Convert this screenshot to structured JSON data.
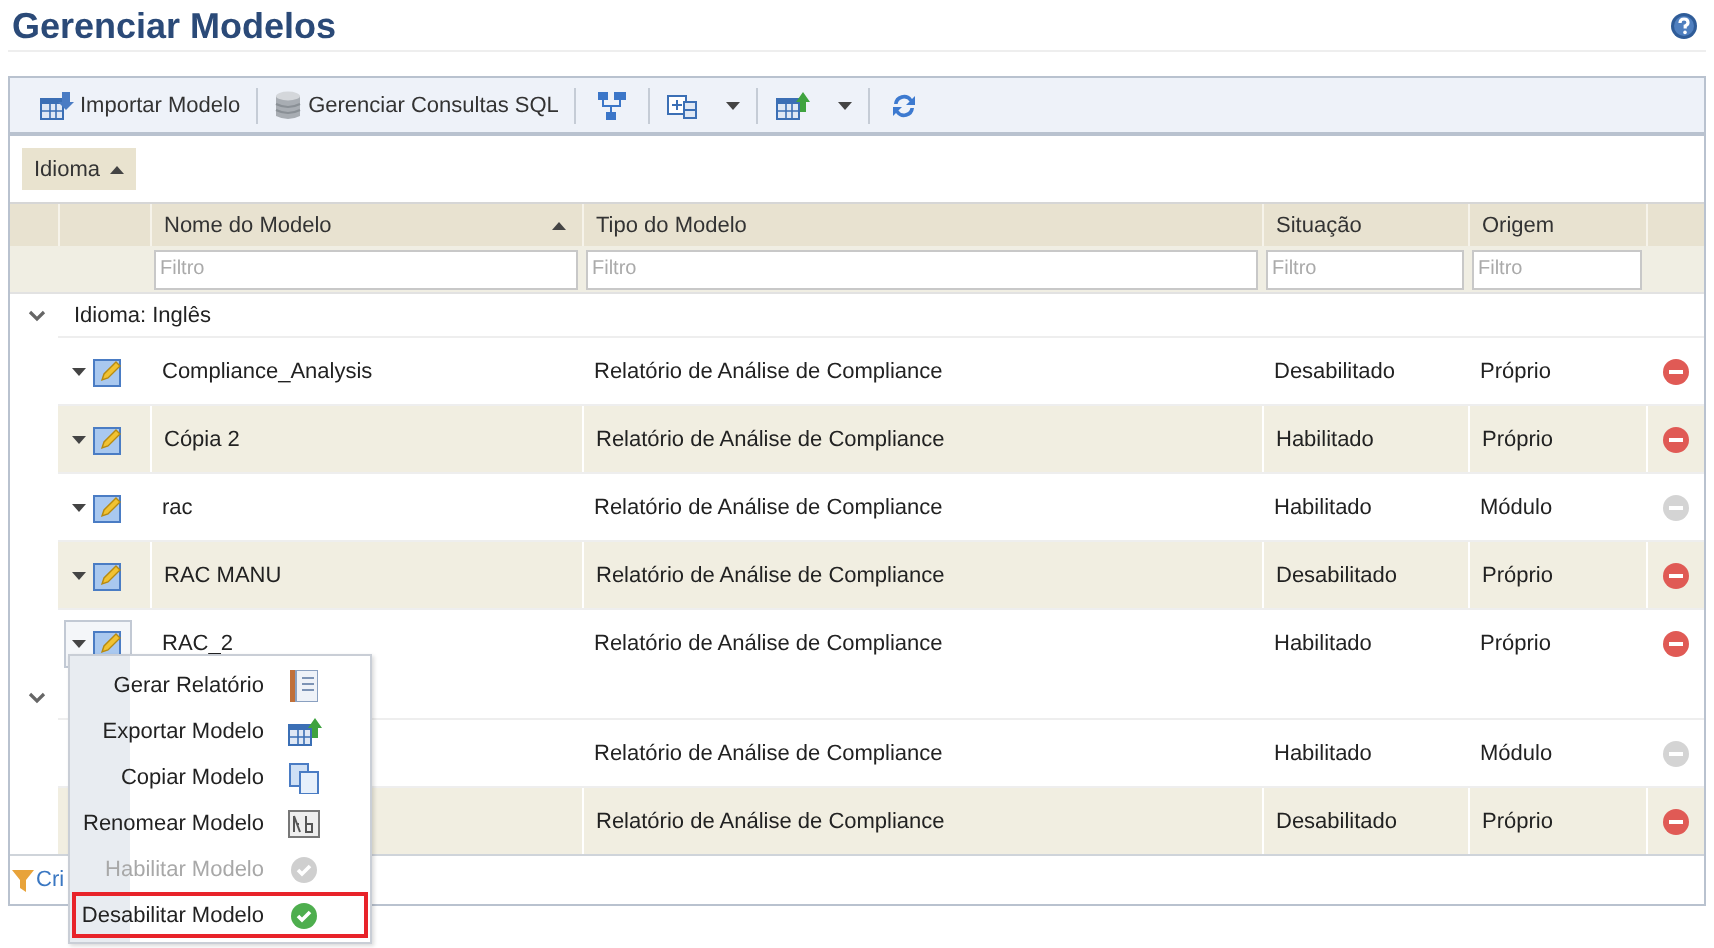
{
  "page": {
    "title": "Gerenciar Modelos"
  },
  "toolbar": [
    {
      "kind": "text-button",
      "label": "Importar Modelo"
    },
    {
      "kind": "text-button",
      "label": "Gerenciar Consultas SQL"
    },
    {
      "kind": "icon-button"
    },
    {
      "kind": "split-button"
    },
    {
      "kind": "split-button"
    },
    {
      "kind": "icon-button"
    }
  ],
  "grouping": {
    "label": "Idioma",
    "sorted": true
  },
  "columns": [
    {
      "label": "Nome do Modelo",
      "sorted": true,
      "filter_placeholder": "Filtro"
    },
    {
      "label": "Tipo do Modelo",
      "filter_placeholder": "Filtro"
    },
    {
      "label": "Situação",
      "filter_placeholder": "Filtro"
    },
    {
      "label": "Origem",
      "filter_placeholder": "Filtro"
    }
  ],
  "groups": [
    {
      "label": "Idioma: Inglês",
      "expanded": true,
      "rows": [
        {
          "name": "Compliance_Analysis",
          "type": "Relatório de Análise de Compliance",
          "status": "Desabilitado",
          "origin": "Próprio",
          "removable": true,
          "selected": false
        },
        {
          "name": "Cópia 2",
          "type": "Relatório de Análise de Compliance",
          "status": "Habilitado",
          "origin": "Próprio",
          "removable": true,
          "selected": false
        },
        {
          "name": "rac",
          "type": "Relatório de Análise de Compliance",
          "status": "Habilitado",
          "origin": "Módulo",
          "removable": false,
          "selected": false
        },
        {
          "name": "RAC MANU",
          "type": "Relatório de Análise de Compliance",
          "status": "Desabilitado",
          "origin": "Próprio",
          "removable": true,
          "selected": false
        },
        {
          "name": "RAC_2",
          "type": "Relatório de Análise de Compliance",
          "status": "Habilitado",
          "origin": "Próprio",
          "removable": true,
          "selected": true
        }
      ]
    },
    {
      "expanded": true,
      "rows": [
        {
          "type": "Relatório de Análise de Compliance",
          "status": "Habilitado",
          "origin": "Módulo",
          "removable": false
        },
        {
          "type": "Relatório de Análise de Compliance",
          "status": "Desabilitado",
          "origin": "Próprio",
          "removable": true
        }
      ]
    }
  ],
  "footer": {
    "link": "Cri"
  },
  "context_menu": [
    {
      "label": "Gerar Relatório",
      "disabled": false,
      "selected": false
    },
    {
      "label": "Exportar Modelo",
      "disabled": false,
      "selected": false
    },
    {
      "label": "Copiar Modelo",
      "disabled": false,
      "selected": false
    },
    {
      "label": "Renomear Modelo",
      "disabled": false,
      "selected": false
    },
    {
      "label": "Habilitar Modelo",
      "disabled": true,
      "selected": false
    },
    {
      "label": "Desabilitar Modelo",
      "disabled": false,
      "selected": true
    }
  ]
}
